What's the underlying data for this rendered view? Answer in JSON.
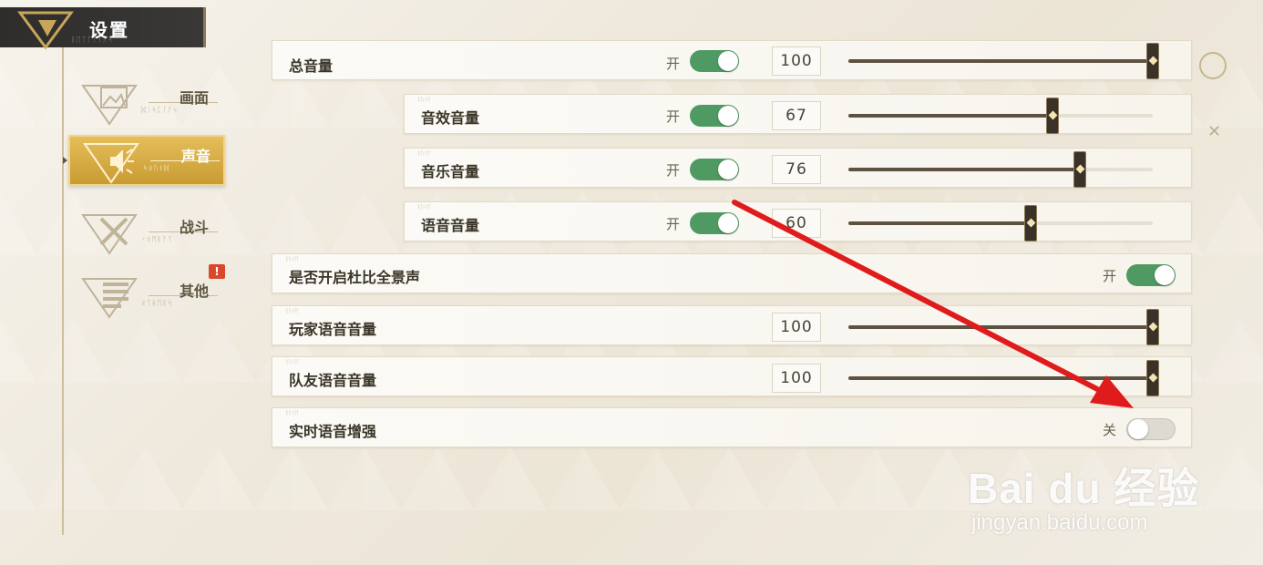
{
  "header": {
    "title": "设置"
  },
  "nav": {
    "items": [
      {
        "label": "画面",
        "active": false
      },
      {
        "label": "声音",
        "active": true
      },
      {
        "label": "战斗",
        "active": false
      },
      {
        "label": "其他",
        "active": false,
        "badge": "!"
      }
    ]
  },
  "settings": {
    "master_volume": {
      "label": "总音量",
      "state": "开",
      "value": "100",
      "level": 1.0
    },
    "sfx_volume": {
      "label": "音效音量",
      "state": "开",
      "value": "67",
      "level": 0.67
    },
    "music_volume": {
      "label": "音乐音量",
      "state": "开",
      "value": "76",
      "level": 0.76
    },
    "voice_volume": {
      "label": "语音音量",
      "state": "开",
      "value": "60",
      "level": 0.6
    },
    "dolby": {
      "label": "是否开启杜比全景声",
      "state": "开"
    },
    "player_voice": {
      "label": "玩家语音音量",
      "value": "100",
      "level": 1.0
    },
    "team_voice": {
      "label": "队友语音音量",
      "value": "100",
      "level": 1.0
    },
    "voice_enhance": {
      "label": "实时语音增强",
      "state": "关"
    }
  },
  "watermark": {
    "logo": "Bai du 经验",
    "url": "jingyan.baidu.com"
  },
  "colors": {
    "toggle_on": "#4f9a62",
    "toggle_off": "#dedad2",
    "active_tab": "#d8ab44",
    "slider_fill": "#5d5242",
    "annotation_arrow": "#e01b1b",
    "badge": "#d9482c"
  }
}
